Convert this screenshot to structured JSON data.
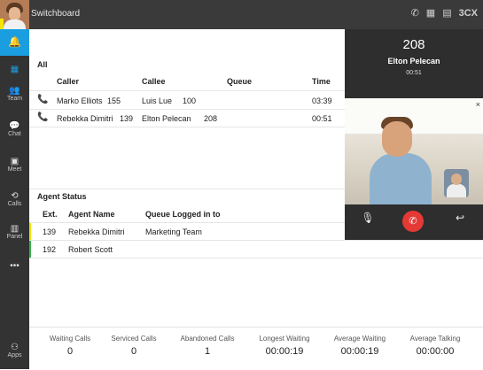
{
  "app": {
    "title": "Switchboard",
    "logo": "3CX",
    "accent": "#1a9ee0"
  },
  "top_icons": [
    "phone-icon",
    "qr-code-icon",
    "book-icon"
  ],
  "sidebar": {
    "items": [
      {
        "name": "bell",
        "label": ""
      },
      {
        "name": "windows",
        "label": ""
      },
      {
        "name": "team",
        "label": "Team"
      },
      {
        "name": "chat",
        "label": "Chat"
      },
      {
        "name": "meet",
        "label": "Meet"
      },
      {
        "name": "calls",
        "label": "Calls"
      },
      {
        "name": "panel",
        "label": "Panel"
      },
      {
        "name": "more",
        "label": ""
      },
      {
        "name": "apps",
        "label": "Apps"
      }
    ]
  },
  "calls": {
    "title": "All",
    "headers": {
      "caller": "Caller",
      "callee": "Callee",
      "queue": "Queue",
      "time": "Time"
    },
    "rows": [
      {
        "caller_name": "Marko Elliots",
        "caller_ext": "155",
        "callee_name": "Luis Lue",
        "callee_ext": "100",
        "queue": "",
        "time": "03:39"
      },
      {
        "caller_name": "Rebekka Dimitri",
        "caller_ext": "139",
        "callee_name": "Elton Pelecan",
        "callee_ext": "208",
        "queue": "",
        "time": "00:51"
      }
    ]
  },
  "agents": {
    "title": "Agent Status",
    "headers": {
      "ext": "Ext.",
      "name": "Agent Name",
      "queue": "Queue Logged in to"
    },
    "rows": [
      {
        "ext": "139",
        "name": "Rebekka Dimitri",
        "queue": "Marketing Team",
        "status_color": "#f2e600"
      },
      {
        "ext": "192",
        "name": "Robert Scott",
        "queue": "",
        "status_color": "#35b34a"
      }
    ]
  },
  "stats": [
    {
      "label": "Waiting Calls",
      "value": "0"
    },
    {
      "label": "Serviced Calls",
      "value": "0"
    },
    {
      "label": "Abandoned Calls",
      "value": "1"
    },
    {
      "label": "Longest Waiting",
      "value": "00:00:19"
    },
    {
      "label": "Average Waiting",
      "value": "00:00:19"
    },
    {
      "label": "Average Talking",
      "value": "00:00:00"
    }
  ],
  "active_call": {
    "ext": "208",
    "name": "Elton Pelecan",
    "duration": "00:51",
    "close": "×"
  },
  "call_controls": [
    "microphone-icon",
    "hangup-icon",
    "transfer-icon"
  ]
}
